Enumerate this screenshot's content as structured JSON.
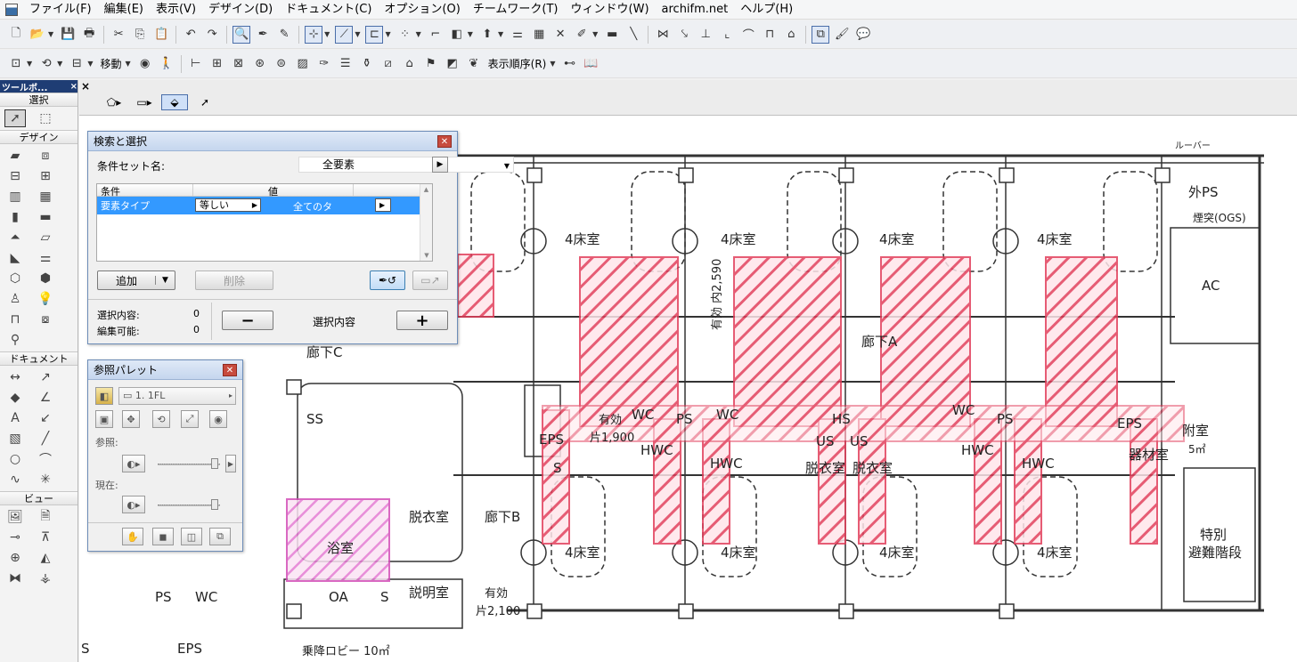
{
  "menu": [
    "ファイル(F)",
    "編集(E)",
    "表示(V)",
    "デザイン(D)",
    "ドキュメント(C)",
    "オプション(O)",
    "チームワーク(T)",
    "ウィンドウ(W)",
    "archifm.net",
    "ヘルプ(H)"
  ],
  "toolbar2": {
    "move_label": "移動",
    "display_order_label": "表示順序(R)"
  },
  "toolbox": {
    "title": "ツールボ...",
    "close": "×",
    "sections": {
      "select": "選択",
      "design": "デザイン",
      "document": "ドキュメント",
      "view": "ビュー"
    }
  },
  "canvas": {
    "close": "×"
  },
  "find_select": {
    "title": "検索と選択",
    "criteria_set_label": "条件セット名:",
    "criteria_set_value": "全要素",
    "table_header_condition": "条件",
    "table_header_value": "値",
    "row_criterion": "要素タイプ",
    "row_operator": "等しい",
    "row_value": "全てのタ",
    "add_button": "追加",
    "delete_button": "削除",
    "selection_label": "選択内容:",
    "selection_count": "0",
    "editable_label": "編集可能:",
    "editable_count": "0",
    "minus": "−",
    "plus": "+",
    "selection_center_label": "選択内容"
  },
  "ref_palette": {
    "title": "参照パレット",
    "layer_value": "1. 1FL",
    "reference_label": "参照:",
    "current_label": "現在:"
  },
  "plan": {
    "labels": {
      "room4_1": "4床室",
      "room4_2": "4床室",
      "room4_3": "4床室",
      "room4_4": "4床室",
      "room4_5": "4床室",
      "room4_6": "4床室",
      "room4_7": "4床室",
      "room4_8": "4床室",
      "corridor_a": "廊下A",
      "corridor_b": "廊下B",
      "corridor_c": "廊下C",
      "eps1": "EPS",
      "eps2": "EPS",
      "eps3": "EPS",
      "ss": "SS",
      "ps1": "PS",
      "ps2": "PS",
      "ps3": "PS",
      "s1": "S",
      "s2": "S",
      "wc1": "WC",
      "wc2": "WC",
      "wc3": "WC",
      "wc4": "WC",
      "hwc1": "HWC",
      "hwc2": "HWC",
      "hwc3": "HWC",
      "hwc4": "HWC",
      "hs": "HS",
      "us1": "US",
      "us2": "US",
      "changing1": "脱衣室",
      "changing2": "脱衣室",
      "changing3": "脱衣室",
      "bath": "浴室",
      "explain": "説明室",
      "oa": "OA",
      "outer_ps": "外PS",
      "smoke": "煙突(OGS)",
      "ac": "AC",
      "annex": "附室",
      "annex_area": "5㎡",
      "machine": "器材室",
      "special_stair_1": "特別",
      "special_stair_2": "避難階段",
      "effective1": "有効",
      "effective1_val": "片1,900",
      "effective2": "有効",
      "effective2_val": "片2,100",
      "effective3": "有効 内2,590",
      "louver": "ルーバー",
      "elevator_lobby": "乗降ロビー 10㎡",
      "bottom_s": "S"
    }
  }
}
